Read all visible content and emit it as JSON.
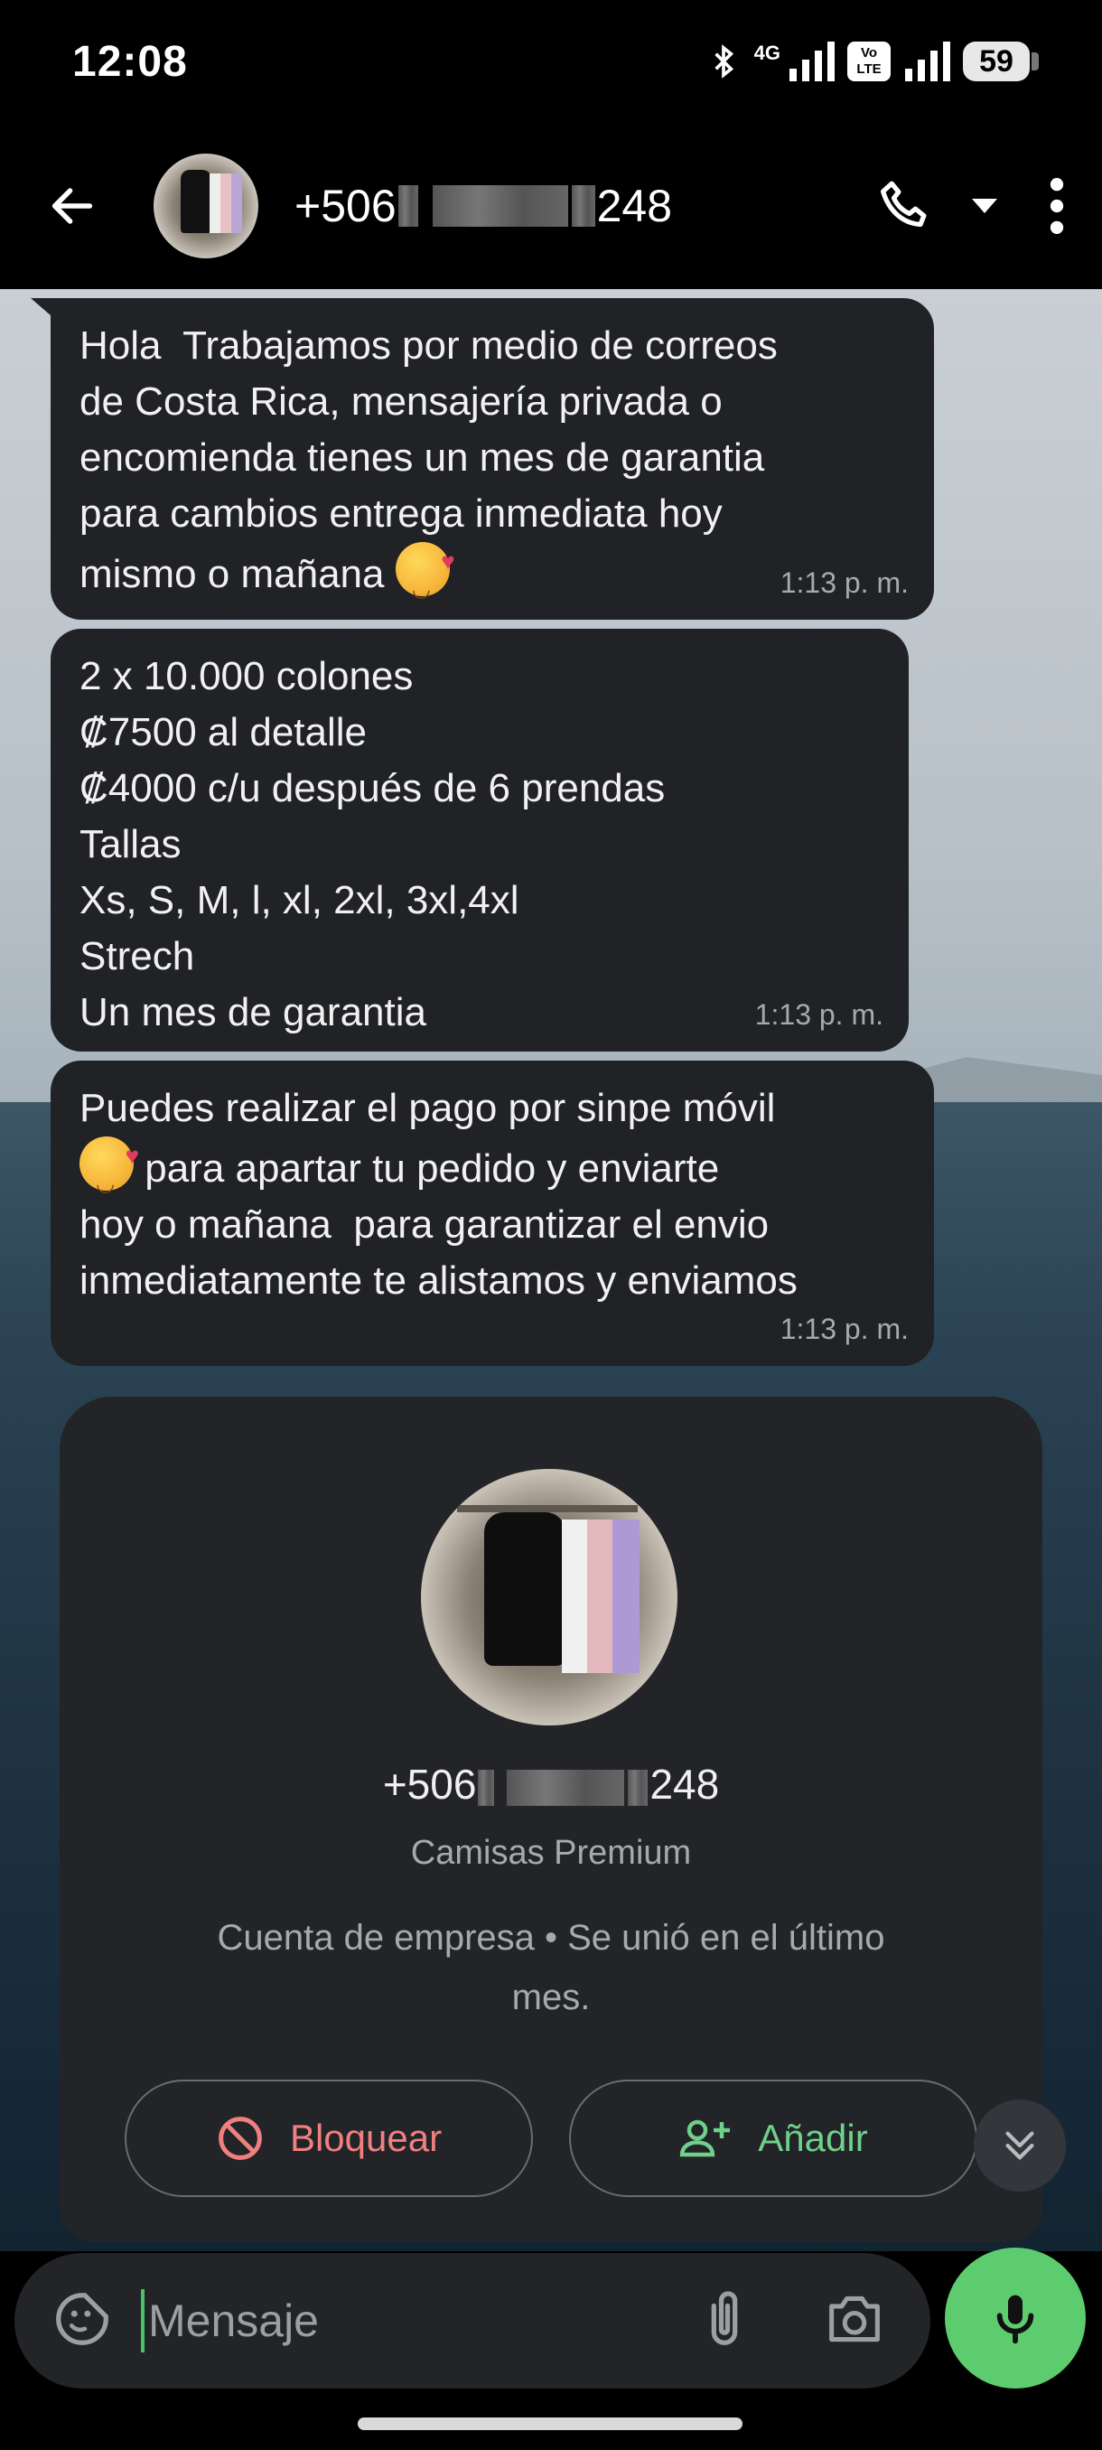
{
  "status_bar": {
    "time": "12:08",
    "network": "4G",
    "volte": "Vo LTE",
    "battery": "59"
  },
  "header": {
    "number_prefix": "+506",
    "number_suffix": "248",
    "icons": [
      "back-arrow-icon",
      "phone-icon",
      "dropdown-icon",
      "more-vert-icon"
    ]
  },
  "messages": [
    {
      "lines": [
        "Hola  Trabajamos por medio de correos",
        "de Costa Rica, mensajería privada o",
        "encomienda tienes un mes de garantia",
        "para cambios entrega inmediata hoy",
        "mismo o mañana"
      ],
      "emoji": "smiling-face-with-hearts",
      "time": "1:13 p. m."
    },
    {
      "lines": [
        "2 x 10.000 colones",
        "₡7500 al detalle",
        "₡4000 c/u después de 6 prendas",
        "Tallas",
        "Xs, S, M, l, xl, 2xl, 3xl,4xl",
        "Strech",
        "Un mes de garantia"
      ],
      "time": "1:13 p. m."
    },
    {
      "lines": [
        "Puedes realizar el pago por sinpe móvil",
        " para apartar tu pedido y enviarte",
        "hoy o mañana  para garantizar el envio",
        "inmediatamente te alistamos y enviamos"
      ],
      "emoji": "smiling-face-with-hearts",
      "time": "1:13 p. m."
    }
  ],
  "contact_card": {
    "number_prefix": "+506",
    "number_suffix": "248",
    "name": "Camisas Premium",
    "desc_line1": "Cuenta de empresa  •  Se unió en el último",
    "desc_line2": "mes.",
    "block_label": "Bloquear",
    "add_label": "Añadir"
  },
  "composer": {
    "placeholder": "Mensaje"
  },
  "colors": {
    "accent_green": "#5dcc6f",
    "block_red": "#f08080",
    "add_green": "#6fd08a",
    "bubble_bg": "#202225"
  }
}
